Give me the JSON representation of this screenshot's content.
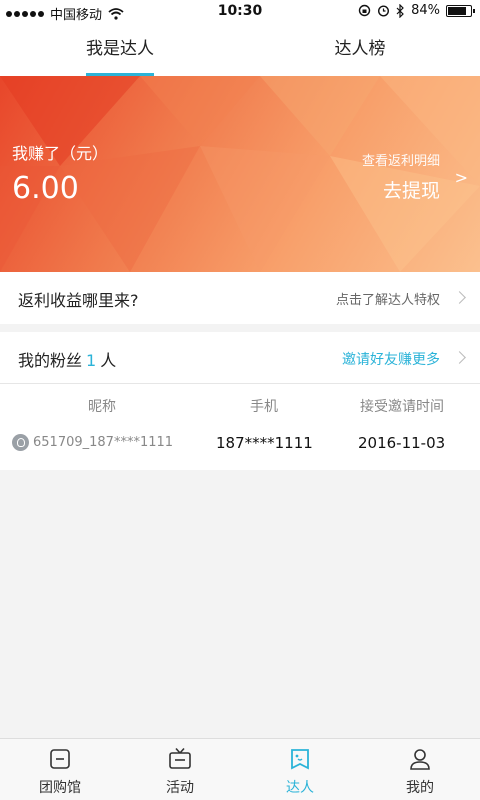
{
  "status_bar": {
    "carrier": "中国移动",
    "time": "10:30",
    "battery": "84%",
    "battery_level": 0.84
  },
  "top_tabs": [
    {
      "label": "我是达人",
      "active": true
    },
    {
      "label": "达人榜",
      "active": false
    }
  ],
  "banner": {
    "earn_label": "我赚了（元）",
    "amount": "6.00",
    "detail_link": "查看返利明细",
    "withdraw_label": "去提现",
    "chevron": ">"
  },
  "rebate_source": {
    "title": "返利收益哪里来?",
    "link": "点击了解达人特权"
  },
  "fans": {
    "title_prefix": "我的粉丝",
    "count": "1",
    "title_suffix": "人",
    "invite_link": "邀请好友赚更多",
    "columns": [
      "昵称",
      "手机",
      "接受邀请时间"
    ],
    "rows": [
      {
        "nickname": "651709_187****1111",
        "phone": "187****1111",
        "date": "2016-11-03"
      }
    ]
  },
  "bottom_nav": [
    {
      "label": "团购馆",
      "icon": "home-box-icon",
      "active": false
    },
    {
      "label": "活动",
      "icon": "tv-icon",
      "active": false
    },
    {
      "label": "达人",
      "icon": "talent-tag-icon",
      "active": true
    },
    {
      "label": "我的",
      "icon": "user-icon",
      "active": false
    }
  ],
  "colors": {
    "accent": "#2bb3d8",
    "banner_start": "#e8462a",
    "banner_end": "#fbc08e"
  }
}
